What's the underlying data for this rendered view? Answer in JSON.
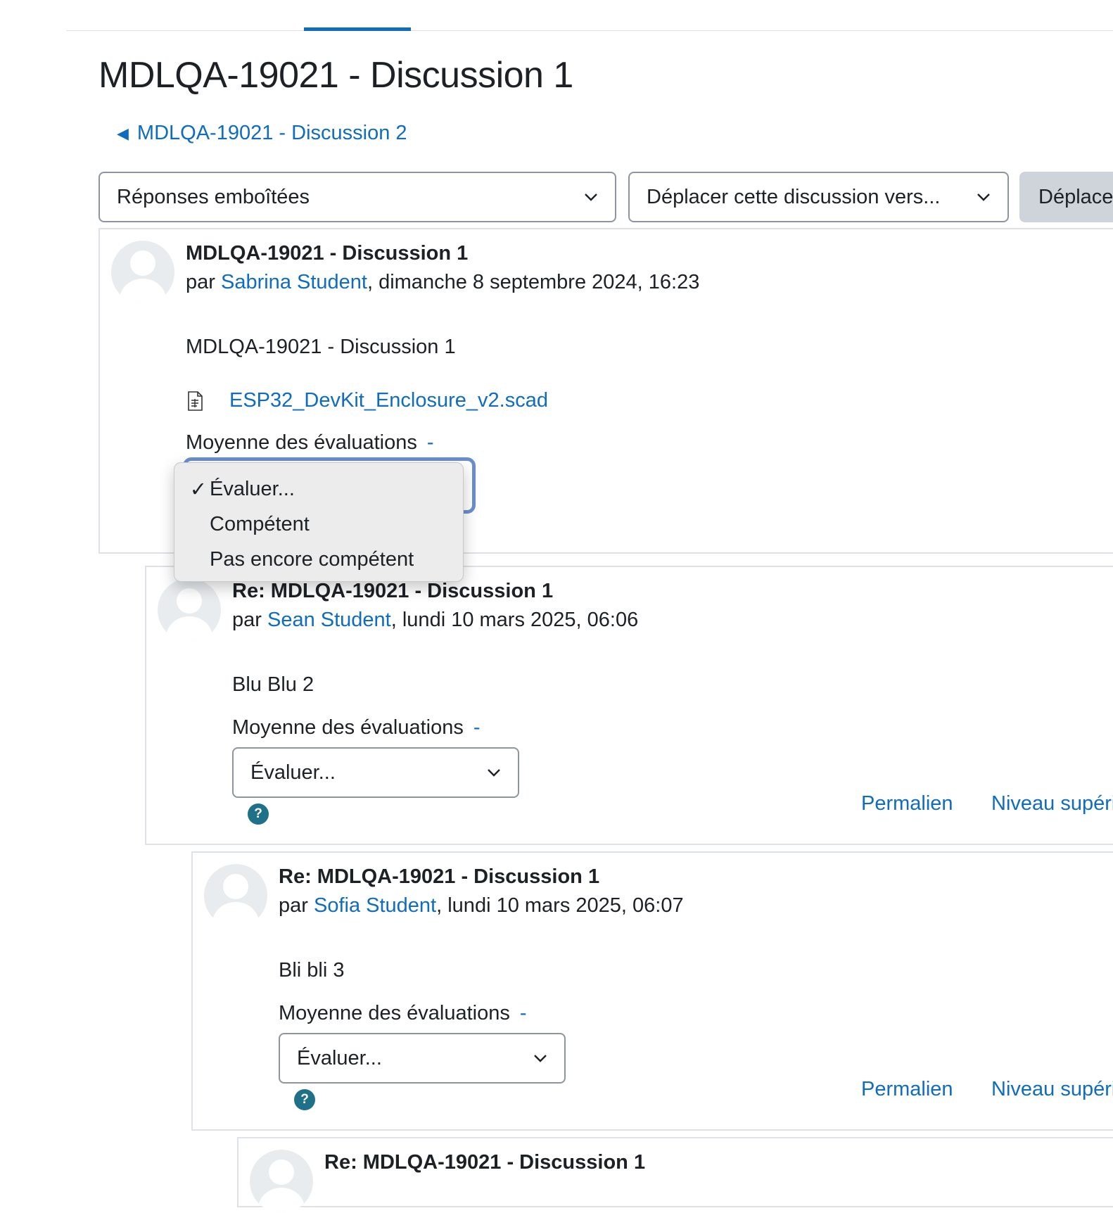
{
  "page": {
    "title": "MDLQA-19021 - Discussion 1",
    "prev_discussion": "MDLQA-19021 - Discussion 2"
  },
  "toolbar": {
    "display_mode": "Réponses emboîtées",
    "move_select": "Déplacer cette discussion vers...",
    "move_button": "Déplacer"
  },
  "rating_menu": {
    "options": [
      {
        "label": "Évaluer...",
        "checked": "✓"
      },
      {
        "label": "Compétent",
        "checked": ""
      },
      {
        "label": "Pas encore compétent",
        "checked": ""
      }
    ]
  },
  "posts": [
    {
      "subject": "MDLQA-19021 - Discussion 1",
      "by": "par",
      "author": "Sabrina Student",
      "date": ", dimanche 8 septembre 2024, 16:23",
      "message": "MDLQA-19021 - Discussion 1",
      "attachment": "ESP32_DevKit_Enclosure_v2.scad",
      "rating_label": "Moyenne des évaluations",
      "rating_value": "-"
    },
    {
      "subject": "Re: MDLQA-19021 - Discussion 1",
      "by": "par",
      "author": "Sean Student",
      "date": ", lundi 10 mars 2025, 06:06",
      "message": "Blu Blu 2",
      "rating_label": "Moyenne des évaluations",
      "rating_value": "-",
      "rate_select": "Évaluer...",
      "help": "?",
      "permalink": "Permalien",
      "parent": "Niveau supérieur"
    },
    {
      "subject": "Re: MDLQA-19021 - Discussion 1",
      "by": "par",
      "author": "Sofia Student",
      "date": ", lundi 10 mars 2025, 06:07",
      "message": "Bli bli 3",
      "rating_label": "Moyenne des évaluations",
      "rating_value": "-",
      "rate_select": "Évaluer...",
      "help": "?",
      "permalink": "Permalien",
      "parent": "Niveau supérieur"
    },
    {
      "subject": "Re: MDLQA-19021 - Discussion 1"
    }
  ],
  "colors": {
    "link": "#0f6cbf",
    "text": "#1d2125",
    "help_icon": "#1f7089",
    "focus_ring": "#6a8fcc"
  }
}
